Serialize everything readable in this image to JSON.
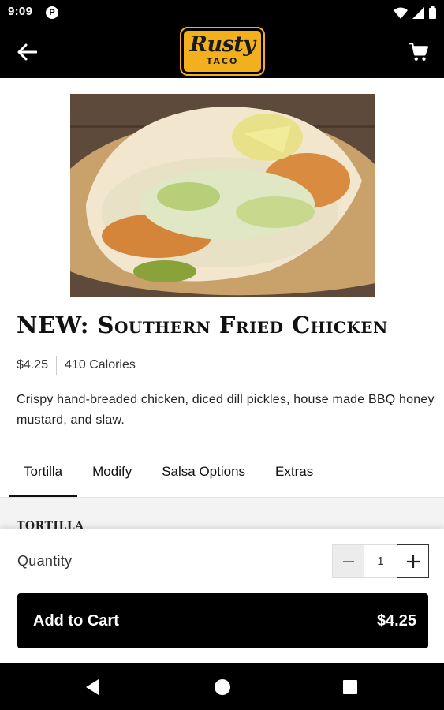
{
  "status": {
    "time": "9:09",
    "app_badge": "P"
  },
  "logo": {
    "main": "Rusty",
    "sub": "TACO"
  },
  "item": {
    "title": "NEW: Southern Fried Chicken",
    "price": "$4.25",
    "calories": "410 Calories",
    "description": "Crispy hand-breaded chicken, diced dill pickles, house made BBQ honey mustard, and slaw."
  },
  "tabs": [
    {
      "label": "Tortilla",
      "active": true
    },
    {
      "label": "Modify"
    },
    {
      "label": "Salsa Options"
    },
    {
      "label": "Extras"
    }
  ],
  "section": {
    "heading": "TORTILLA"
  },
  "quantity": {
    "label": "Quantity",
    "value": "1"
  },
  "cart_button": {
    "label": "Add to Cart",
    "price": "$4.25"
  },
  "icons": {
    "back": "arrow-left-icon",
    "cart": "shopping-cart-icon",
    "nav_back": "triangle-back-icon",
    "nav_home": "circle-home-icon",
    "nav_recents": "square-recents-icon"
  },
  "colors": {
    "brand": "#f2b01e",
    "bar": "#000000",
    "button": "#000000"
  }
}
